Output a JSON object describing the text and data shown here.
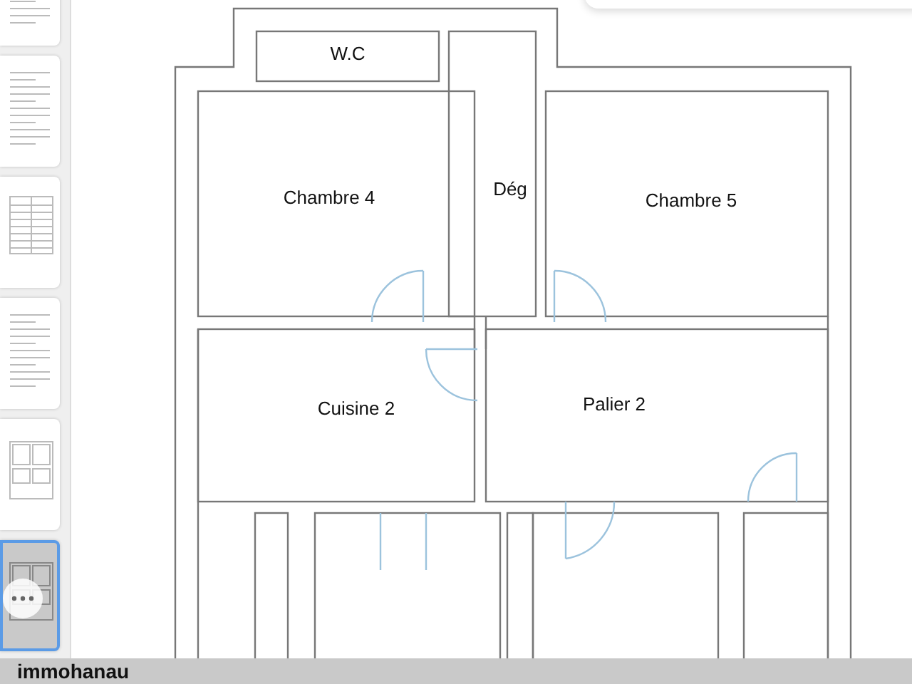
{
  "sidebar": {
    "thumbnails": [
      {
        "kind": "cover",
        "selected": false
      },
      {
        "kind": "text",
        "selected": false
      },
      {
        "kind": "table",
        "selected": false
      },
      {
        "kind": "text",
        "selected": false
      },
      {
        "kind": "plan",
        "selected": false
      },
      {
        "kind": "plan",
        "selected": true
      }
    ]
  },
  "floor_plan": {
    "rooms": [
      {
        "name": "W.C"
      },
      {
        "name": "Chambre 4"
      },
      {
        "name": "Dég"
      },
      {
        "name": "Chambre 5"
      },
      {
        "name": "Cuisine 2"
      },
      {
        "name": "Palier 2"
      }
    ]
  },
  "footer": {
    "text": "immohanau"
  }
}
